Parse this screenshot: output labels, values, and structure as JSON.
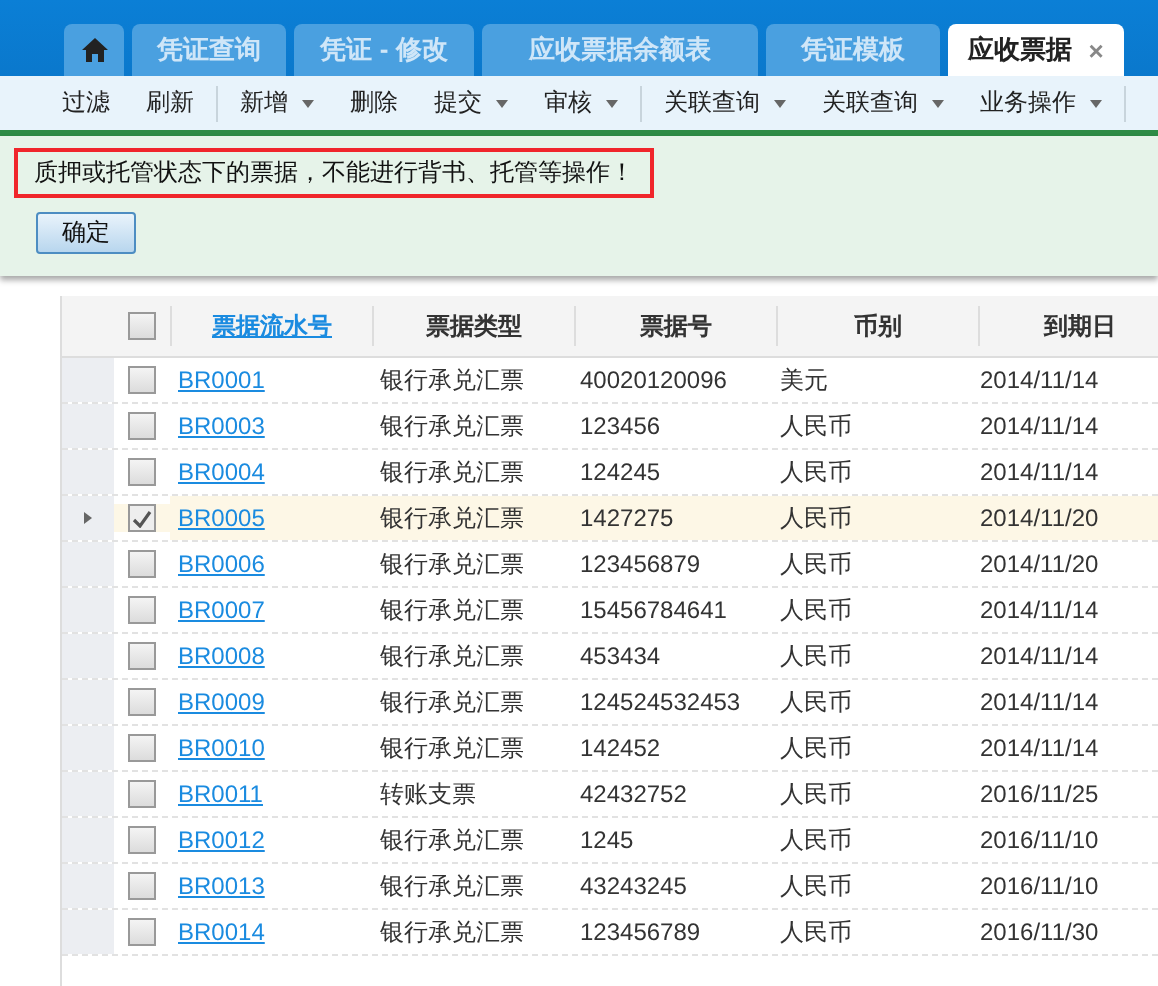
{
  "tabs": [
    {
      "kind": "home",
      "selected": false
    },
    {
      "label": "凭证查询",
      "selected": false,
      "closable": false
    },
    {
      "label": "凭证 - 修改",
      "selected": false,
      "closable": false
    },
    {
      "label": "应收票据余额表",
      "selected": false,
      "closable": false
    },
    {
      "label": "凭证模板",
      "selected": false,
      "closable": false
    },
    {
      "label": "应收票据",
      "selected": true,
      "closable": true,
      "close": "×"
    }
  ],
  "toolbar": [
    {
      "items": [
        {
          "label": "过滤",
          "dropdown": false
        },
        {
          "label": "刷新",
          "dropdown": false
        }
      ]
    },
    {
      "items": [
        {
          "label": "新增",
          "dropdown": true
        },
        {
          "label": "删除",
          "dropdown": false
        },
        {
          "label": "提交",
          "dropdown": true
        },
        {
          "label": "审核",
          "dropdown": true
        }
      ]
    },
    {
      "items": [
        {
          "label": "关联查询",
          "dropdown": true
        },
        {
          "label": "关联查询",
          "dropdown": true
        },
        {
          "label": "业务操作",
          "dropdown": true
        }
      ]
    }
  ],
  "message": {
    "text": "质押或托管状态下的票据，不能进行背书、托管等操作！",
    "button": "确定"
  },
  "table": {
    "select_all": {
      "checked": false
    },
    "columns": [
      "票据流水号",
      "票据类型",
      "票据号",
      "币别",
      "到期日"
    ],
    "rows": [
      {
        "cells": [
          "BR0001",
          "银行承兑汇票",
          "40020120096",
          "美元",
          "2014/11/14"
        ],
        "checked": false,
        "selected": false
      },
      {
        "cells": [
          "BR0003",
          "银行承兑汇票",
          "123456",
          "人民币",
          "2014/11/14"
        ],
        "checked": false,
        "selected": false
      },
      {
        "cells": [
          "BR0004",
          "银行承兑汇票",
          "124245",
          "人民币",
          "2014/11/14"
        ],
        "checked": false,
        "selected": false
      },
      {
        "cells": [
          "BR0005",
          "银行承兑汇票",
          "1427275",
          "人民币",
          "2014/11/20"
        ],
        "checked": true,
        "selected": true
      },
      {
        "cells": [
          "BR0006",
          "银行承兑汇票",
          "123456879",
          "人民币",
          "2014/11/20"
        ],
        "checked": false,
        "selected": false
      },
      {
        "cells": [
          "BR0007",
          "银行承兑汇票",
          "15456784641",
          "人民币",
          "2014/11/14"
        ],
        "checked": false,
        "selected": false
      },
      {
        "cells": [
          "BR0008",
          "银行承兑汇票",
          "453434",
          "人民币",
          "2014/11/14"
        ],
        "checked": false,
        "selected": false
      },
      {
        "cells": [
          "BR0009",
          "银行承兑汇票",
          "124524532453",
          "人民币",
          "2014/11/14"
        ],
        "checked": false,
        "selected": false
      },
      {
        "cells": [
          "BR0010",
          "银行承兑汇票",
          "142452",
          "人民币",
          "2014/11/14"
        ],
        "checked": false,
        "selected": false
      },
      {
        "cells": [
          "BR0011",
          "转账支票",
          "42432752",
          "人民币",
          "2016/11/25"
        ],
        "checked": false,
        "selected": false
      },
      {
        "cells": [
          "BR0012",
          "银行承兑汇票",
          "1245",
          "人民币",
          "2016/11/10"
        ],
        "checked": false,
        "selected": false
      },
      {
        "cells": [
          "BR0013",
          "银行承兑汇票",
          "43243245",
          "人民币",
          "2016/11/10"
        ],
        "checked": false,
        "selected": false
      },
      {
        "cells": [
          "BR0014",
          "银行承兑汇票",
          "123456789",
          "人民币",
          "2016/11/30"
        ],
        "checked": false,
        "selected": false
      }
    ]
  }
}
